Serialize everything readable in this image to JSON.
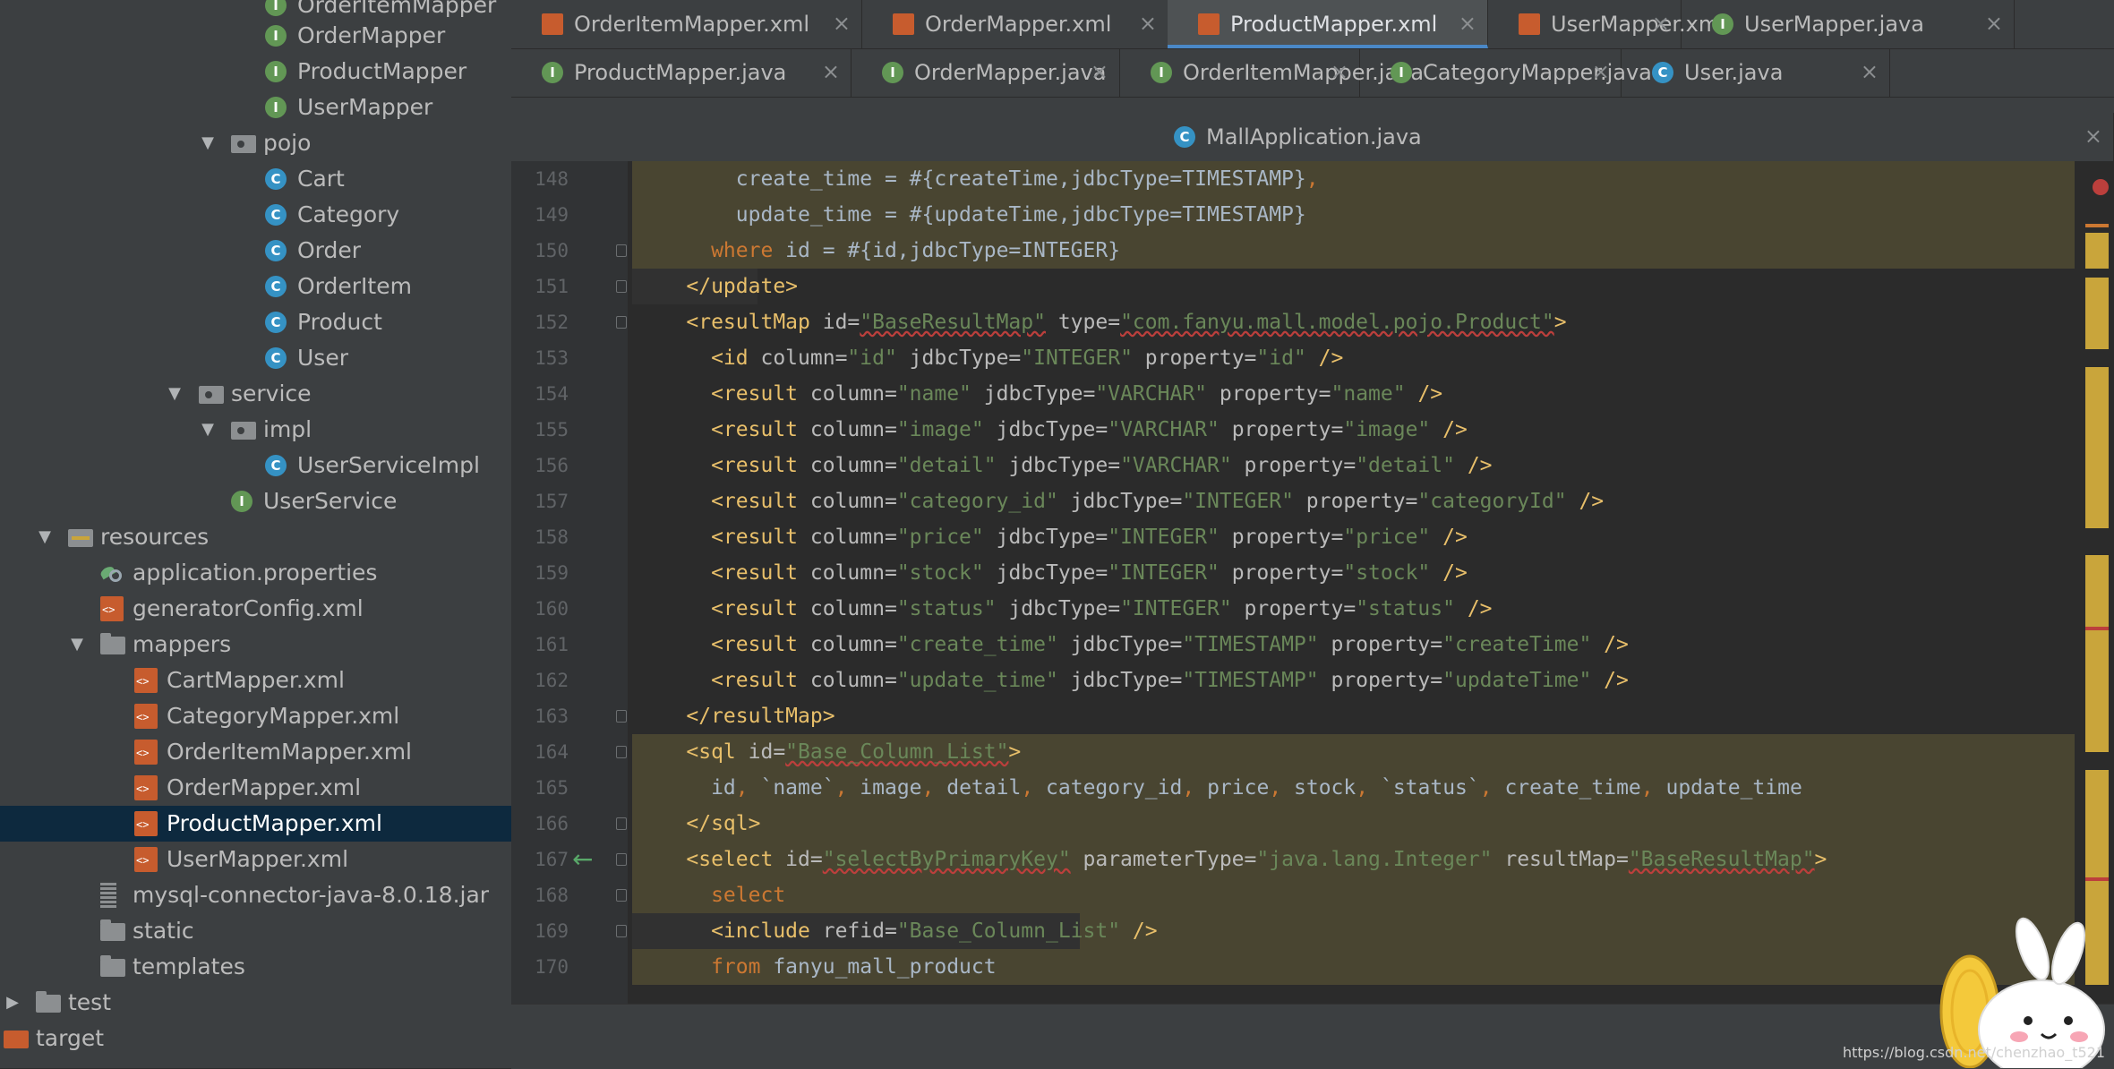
{
  "sidebar": {
    "items": [
      {
        "label": "OrderItemMapper",
        "kind": "interface",
        "selected": false
      },
      {
        "label": "OrderMapper",
        "kind": "interface",
        "selected": false
      },
      {
        "label": "ProductMapper",
        "kind": "interface",
        "selected": false
      },
      {
        "label": "UserMapper",
        "kind": "interface",
        "selected": false
      },
      {
        "label": "pojo",
        "kind": "package",
        "selected": false
      },
      {
        "label": "Cart",
        "kind": "class",
        "selected": false
      },
      {
        "label": "Category",
        "kind": "class",
        "selected": false
      },
      {
        "label": "Order",
        "kind": "class",
        "selected": false
      },
      {
        "label": "OrderItem",
        "kind": "class",
        "selected": false
      },
      {
        "label": "Product",
        "kind": "class",
        "selected": false
      },
      {
        "label": "User",
        "kind": "class",
        "selected": false
      },
      {
        "label": "service",
        "kind": "package",
        "selected": false
      },
      {
        "label": "impl",
        "kind": "package",
        "selected": false
      },
      {
        "label": "UserServiceImpl",
        "kind": "class",
        "selected": false
      },
      {
        "label": "UserService",
        "kind": "interface",
        "selected": false
      },
      {
        "label": "resources",
        "kind": "resources-folder",
        "selected": false
      },
      {
        "label": "application.properties",
        "kind": "properties",
        "selected": false
      },
      {
        "label": "generatorConfig.xml",
        "kind": "xml",
        "selected": false
      },
      {
        "label": "mappers",
        "kind": "folder",
        "selected": false
      },
      {
        "label": "CartMapper.xml",
        "kind": "xml",
        "selected": false
      },
      {
        "label": "CategoryMapper.xml",
        "kind": "xml",
        "selected": false
      },
      {
        "label": "OrderItemMapper.xml",
        "kind": "xml",
        "selected": false
      },
      {
        "label": "OrderMapper.xml",
        "kind": "xml",
        "selected": false
      },
      {
        "label": "ProductMapper.xml",
        "kind": "xml",
        "selected": true
      },
      {
        "label": "UserMapper.xml",
        "kind": "xml",
        "selected": false
      },
      {
        "label": "mysql-connector-java-8.0.18.jar",
        "kind": "jar",
        "selected": false
      },
      {
        "label": "static",
        "kind": "folder",
        "selected": false
      },
      {
        "label": "templates",
        "kind": "folder",
        "selected": false
      },
      {
        "label": "test",
        "kind": "folder",
        "selected": false
      },
      {
        "label": "target",
        "kind": "target-folder",
        "selected": false
      }
    ]
  },
  "tabs": {
    "row1": [
      {
        "label": "OrderItemMapper.xml",
        "icon": "xml-file-icon",
        "active": false
      },
      {
        "label": "OrderMapper.xml",
        "icon": "xml-file-icon",
        "active": false
      },
      {
        "label": "ProductMapper.xml",
        "icon": "xml-file-icon",
        "active": true
      },
      {
        "label": "UserMapper.xml",
        "icon": "xml-file-icon",
        "active": false
      },
      {
        "label": "UserMapper.java",
        "icon": "interface-icon",
        "active": false
      }
    ],
    "row2": [
      {
        "label": "ProductMapper.java",
        "icon": "interface-icon",
        "active": false
      },
      {
        "label": "OrderMapper.java",
        "icon": "interface-icon",
        "active": false
      },
      {
        "label": "OrderItemMapper.java",
        "icon": "interface-icon",
        "active": false
      },
      {
        "label": "CategoryMapper.java",
        "icon": "interface-icon",
        "active": false
      },
      {
        "label": "User.java",
        "icon": "class-icon",
        "active": false
      }
    ],
    "row3": [
      {
        "label": "MallApplication.java",
        "icon": "spring-boot-class-icon",
        "active": false
      }
    ],
    "close_glyph": "×"
  },
  "editor": {
    "lines": [
      {
        "n": "148",
        "tokens": [
          [
            "plain",
            "        create_time = #{createTime,jdbcType=TIMESTAMP}"
          ],
          [
            "kw",
            ","
          ]
        ]
      },
      {
        "n": "149",
        "tokens": [
          [
            "plain",
            "        update_time = #{updateTime,jdbcType=TIMESTAMP}"
          ]
        ]
      },
      {
        "n": "150",
        "tokens": [
          [
            "kw",
            "      where "
          ],
          [
            "plain",
            "id = #{id,jdbcType=INTEGER}"
          ]
        ]
      },
      {
        "n": "151",
        "tokens": [
          [
            "tag",
            "    </update>"
          ]
        ]
      },
      {
        "n": "152",
        "tokens": [
          [
            "tag",
            "    <resultMap "
          ],
          [
            "attr",
            "id="
          ],
          [
            "val",
            "\"BaseResultMap\""
          ],
          [
            "attr",
            " type="
          ],
          [
            "val",
            "\"com.fanyu.mall.model.pojo.Product\""
          ],
          [
            "tag",
            ">"
          ]
        ]
      },
      {
        "n": "153",
        "tokens": [
          [
            "tag",
            "      <id "
          ],
          [
            "attr",
            "column="
          ],
          [
            "val",
            "\"id\""
          ],
          [
            "attr",
            " jdbcType="
          ],
          [
            "val",
            "\"INTEGER\""
          ],
          [
            "attr",
            " property="
          ],
          [
            "val",
            "\"id\""
          ],
          [
            "tag",
            " />"
          ]
        ]
      },
      {
        "n": "154",
        "tokens": [
          [
            "tag",
            "      <result "
          ],
          [
            "attr",
            "column="
          ],
          [
            "val",
            "\"name\""
          ],
          [
            "attr",
            " jdbcType="
          ],
          [
            "val",
            "\"VARCHAR\""
          ],
          [
            "attr",
            " property="
          ],
          [
            "val",
            "\"name\""
          ],
          [
            "tag",
            " />"
          ]
        ]
      },
      {
        "n": "155",
        "tokens": [
          [
            "tag",
            "      <result "
          ],
          [
            "attr",
            "column="
          ],
          [
            "val",
            "\"image\""
          ],
          [
            "attr",
            " jdbcType="
          ],
          [
            "val",
            "\"VARCHAR\""
          ],
          [
            "attr",
            " property="
          ],
          [
            "val",
            "\"image\""
          ],
          [
            "tag",
            " />"
          ]
        ]
      },
      {
        "n": "156",
        "tokens": [
          [
            "tag",
            "      <result "
          ],
          [
            "attr",
            "column="
          ],
          [
            "val",
            "\"detail\""
          ],
          [
            "attr",
            " jdbcType="
          ],
          [
            "val",
            "\"VARCHAR\""
          ],
          [
            "attr",
            " property="
          ],
          [
            "val",
            "\"detail\""
          ],
          [
            "tag",
            " />"
          ]
        ]
      },
      {
        "n": "157",
        "tokens": [
          [
            "tag",
            "      <result "
          ],
          [
            "attr",
            "column="
          ],
          [
            "val",
            "\"category_id\""
          ],
          [
            "attr",
            " jdbcType="
          ],
          [
            "val",
            "\"INTEGER\""
          ],
          [
            "attr",
            " property="
          ],
          [
            "val",
            "\"categoryId\""
          ],
          [
            "tag",
            " />"
          ]
        ]
      },
      {
        "n": "158",
        "tokens": [
          [
            "tag",
            "      <result "
          ],
          [
            "attr",
            "column="
          ],
          [
            "val",
            "\"price\""
          ],
          [
            "attr",
            " jdbcType="
          ],
          [
            "val",
            "\"INTEGER\""
          ],
          [
            "attr",
            " property="
          ],
          [
            "val",
            "\"price\""
          ],
          [
            "tag",
            " />"
          ]
        ]
      },
      {
        "n": "159",
        "tokens": [
          [
            "tag",
            "      <result "
          ],
          [
            "attr",
            "column="
          ],
          [
            "val",
            "\"stock\""
          ],
          [
            "attr",
            " jdbcType="
          ],
          [
            "val",
            "\"INTEGER\""
          ],
          [
            "attr",
            " property="
          ],
          [
            "val",
            "\"stock\""
          ],
          [
            "tag",
            " />"
          ]
        ]
      },
      {
        "n": "160",
        "tokens": [
          [
            "tag",
            "      <result "
          ],
          [
            "attr",
            "column="
          ],
          [
            "val",
            "\"status\""
          ],
          [
            "attr",
            " jdbcType="
          ],
          [
            "val",
            "\"INTEGER\""
          ],
          [
            "attr",
            " property="
          ],
          [
            "val",
            "\"status\""
          ],
          [
            "tag",
            " />"
          ]
        ]
      },
      {
        "n": "161",
        "tokens": [
          [
            "tag",
            "      <result "
          ],
          [
            "attr",
            "column="
          ],
          [
            "val",
            "\"create_time\""
          ],
          [
            "attr",
            " jdbcType="
          ],
          [
            "val",
            "\"TIMESTAMP\""
          ],
          [
            "attr",
            " property="
          ],
          [
            "val",
            "\"createTime\""
          ],
          [
            "tag",
            " />"
          ]
        ]
      },
      {
        "n": "162",
        "tokens": [
          [
            "tag",
            "      <result "
          ],
          [
            "attr",
            "column="
          ],
          [
            "val",
            "\"update_time\""
          ],
          [
            "attr",
            " jdbcType="
          ],
          [
            "val",
            "\"TIMESTAMP\""
          ],
          [
            "attr",
            " property="
          ],
          [
            "val",
            "\"updateTime\""
          ],
          [
            "tag",
            " />"
          ]
        ]
      },
      {
        "n": "163",
        "tokens": [
          [
            "tag",
            "    </resultMap>"
          ]
        ]
      },
      {
        "n": "164",
        "tokens": [
          [
            "tag",
            "    <sql "
          ],
          [
            "attr",
            "id="
          ],
          [
            "val",
            "\"Base_Column_List\""
          ],
          [
            "tag",
            ">"
          ]
        ]
      },
      {
        "n": "165",
        "tokens": [
          [
            "plain",
            "      id"
          ],
          [
            "kw",
            ", "
          ],
          [
            "plain",
            "`name`"
          ],
          [
            "kw",
            ", "
          ],
          [
            "plain",
            "image"
          ],
          [
            "kw",
            ", "
          ],
          [
            "plain",
            "detail"
          ],
          [
            "kw",
            ", "
          ],
          [
            "plain",
            "category_id"
          ],
          [
            "kw",
            ", "
          ],
          [
            "plain",
            "price"
          ],
          [
            "kw",
            ", "
          ],
          [
            "plain",
            "stock"
          ],
          [
            "kw",
            ", "
          ],
          [
            "plain",
            "`status`"
          ],
          [
            "kw",
            ", "
          ],
          [
            "plain",
            "create_time"
          ],
          [
            "kw",
            ", "
          ],
          [
            "plain",
            "update_time"
          ]
        ]
      },
      {
        "n": "166",
        "tokens": [
          [
            "tag",
            "    </sql>"
          ]
        ]
      },
      {
        "n": "167",
        "tokens": [
          [
            "tag",
            "    <select "
          ],
          [
            "attr",
            "id="
          ],
          [
            "val",
            "\"selectByPrimaryKey\""
          ],
          [
            "attr",
            " parameterType="
          ],
          [
            "val",
            "\"java.lang.Integer\""
          ],
          [
            "attr",
            " resultMap="
          ],
          [
            "val",
            "\"BaseResultMap\""
          ],
          [
            "tag",
            ">"
          ]
        ]
      },
      {
        "n": "168",
        "tokens": [
          [
            "kw",
            "      select"
          ]
        ]
      },
      {
        "n": "169",
        "tokens": [
          [
            "tag",
            "      <include "
          ],
          [
            "attr",
            "refid="
          ],
          [
            "val",
            "\"Base_Column_List\""
          ],
          [
            "tag",
            " />"
          ]
        ]
      },
      {
        "n": "170",
        "tokens": [
          [
            "kw",
            "      from "
          ],
          [
            "plain",
            "fanyu_mall_product"
          ]
        ]
      }
    ]
  },
  "watermark": "https://blog.csdn.net/chenzhao_t521",
  "colors": {
    "accent": "#4a88c7",
    "xml_tag": "#e8bf6a",
    "string_value": "#6a8759",
    "keyword": "#cc7832",
    "highlight": "#494531",
    "gutter_arrow": "#59a869"
  }
}
